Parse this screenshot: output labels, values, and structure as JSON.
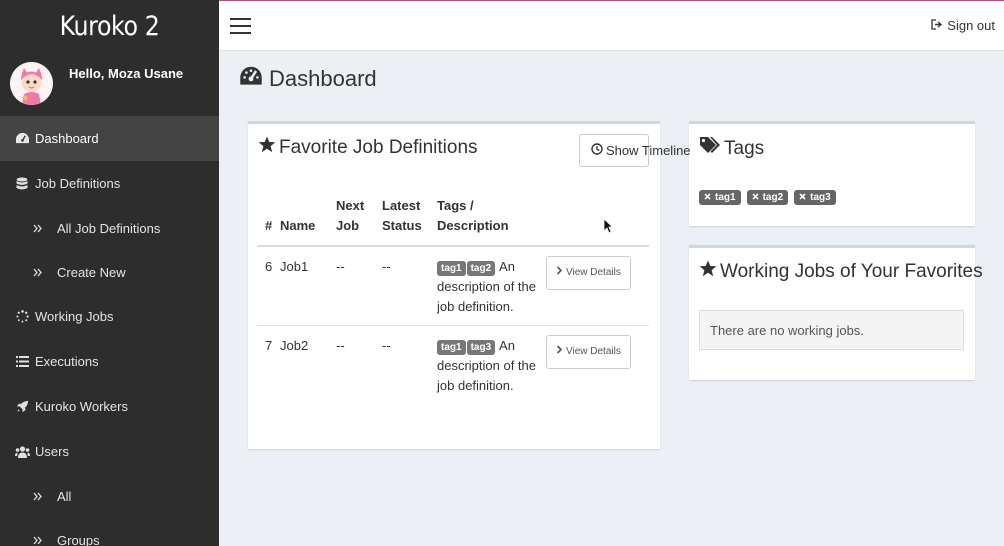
{
  "app": {
    "brand": "Kuroko 2",
    "greeting": "Hello, Moza Usane"
  },
  "sidebar": {
    "items": [
      {
        "label": "Dashboard",
        "icon": "dashboard-icon",
        "active": true
      },
      {
        "label": "Job Definitions",
        "icon": "database-icon"
      },
      {
        "label": "All Job Definitions",
        "icon": "double-angle-right-icon",
        "sub": true
      },
      {
        "label": "Create New",
        "icon": "double-angle-right-icon",
        "sub": true
      },
      {
        "label": "Working Jobs",
        "icon": "spinner-icon"
      },
      {
        "label": "Executions",
        "icon": "list-icon"
      },
      {
        "label": "Kuroko Workers",
        "icon": "rocket-icon"
      },
      {
        "label": "Users",
        "icon": "users-icon"
      },
      {
        "label": "All",
        "icon": "double-angle-right-icon",
        "sub": true
      },
      {
        "label": "Groups",
        "icon": "double-angle-right-icon",
        "sub": true
      }
    ]
  },
  "topbar": {
    "signout_label": "Sign out"
  },
  "page": {
    "title": "Dashboard"
  },
  "favorites": {
    "title": "Favorite Job Definitions",
    "timeline_button": "Show Timeline",
    "columns": [
      "#",
      "Name",
      "Next Job",
      "Latest Status",
      "Tags / Description"
    ],
    "rows": [
      {
        "id": "6",
        "name": "Job1",
        "next": "--",
        "status": "--",
        "tags": [
          "tag1",
          "tag2"
        ],
        "description": "An description of the job definition.",
        "action": "View Details"
      },
      {
        "id": "7",
        "name": "Job2",
        "next": "--",
        "status": "--",
        "tags": [
          "tag1",
          "tag3"
        ],
        "description": "An description of the job definition.",
        "action": "View Details"
      }
    ]
  },
  "tags_box": {
    "title": "Tags",
    "tags": [
      "tag1",
      "tag2",
      "tag3"
    ]
  },
  "working_box": {
    "title": "Working Jobs of Your Favorites",
    "empty_message": "There are no working jobs."
  },
  "colors": {
    "sidebar_bg": "#2d2d2d",
    "sidebar_active": "#444444",
    "tag_bg": "#777777",
    "topbar_accent": "#b0566b"
  }
}
